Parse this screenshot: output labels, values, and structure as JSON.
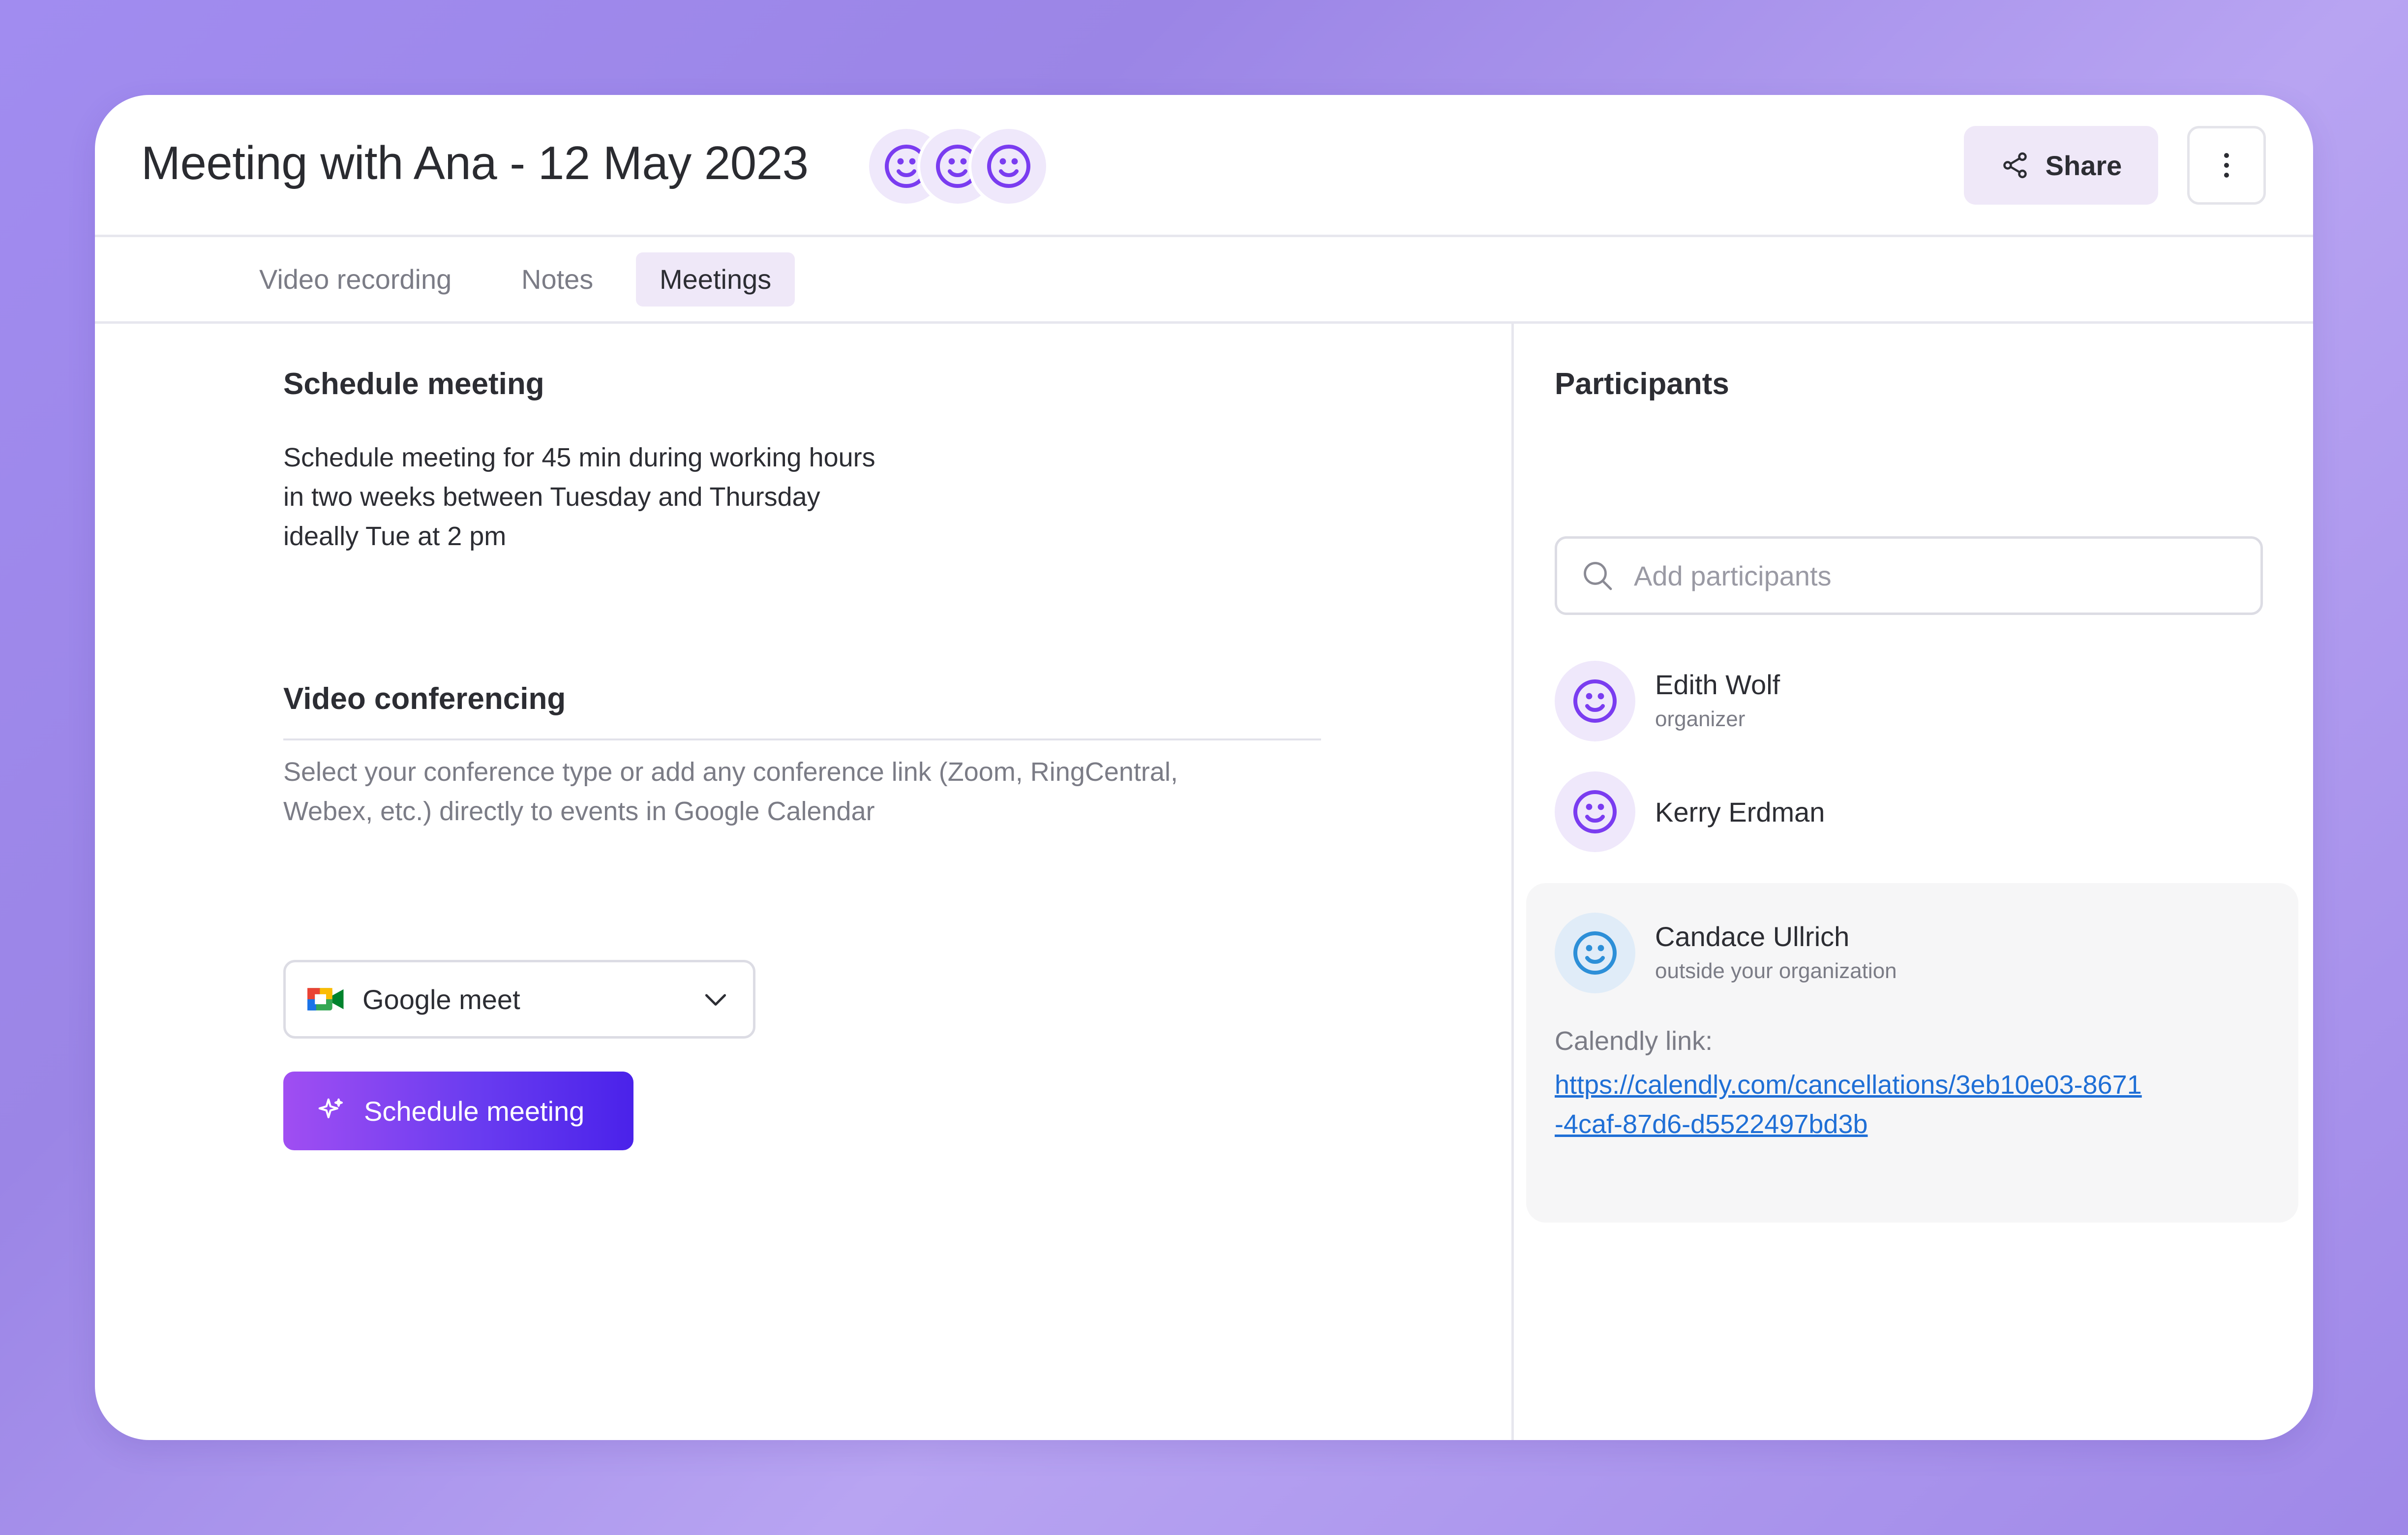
{
  "header": {
    "title": "Meeting with Ana - 12 May 2023",
    "share_label": "Share",
    "avatar_icons": [
      "smiley-icon",
      "smiley-icon",
      "smiley-icon"
    ],
    "more_icon": "vertical-ellipsis-icon"
  },
  "tabs": [
    {
      "label": "Video recording",
      "active": false
    },
    {
      "label": "Notes",
      "active": false
    },
    {
      "label": "Meetings",
      "active": true
    }
  ],
  "schedule": {
    "title": "Schedule meeting",
    "description_lines": [
      "Schedule meeting for 45 min during working hours",
      "in two weeks between Tuesday and Thursday",
      "ideally Tue at 2 pm"
    ]
  },
  "conferencing": {
    "title": "Video conferencing",
    "help_lines": [
      "Select your conference type or add any conference link (Zoom, RingCentral,",
      "Webex, etc.) directly to events in Google Calendar"
    ],
    "selected": "Google meet",
    "button_label": "Schedule meeting"
  },
  "participants": {
    "title": "Participants",
    "search_placeholder": "Add participants",
    "list": [
      {
        "name": "Edith Wolf",
        "role": "organizer"
      },
      {
        "name": "Kerry Erdman",
        "role": ""
      },
      {
        "name": "Candace Ullrich",
        "role": "outside your organization"
      }
    ],
    "calendly_label": "Calendly link:",
    "calendly_url": "https://calendly.com/cancellations/3eb10e03-8671-4caf-87d6-d5522497bd3b"
  },
  "colors": {
    "accent": "#7a3cf0",
    "avatar_bg": "#efe8fb",
    "link": "#1f6fd6",
    "external_avatar": "#2d8fd8"
  }
}
